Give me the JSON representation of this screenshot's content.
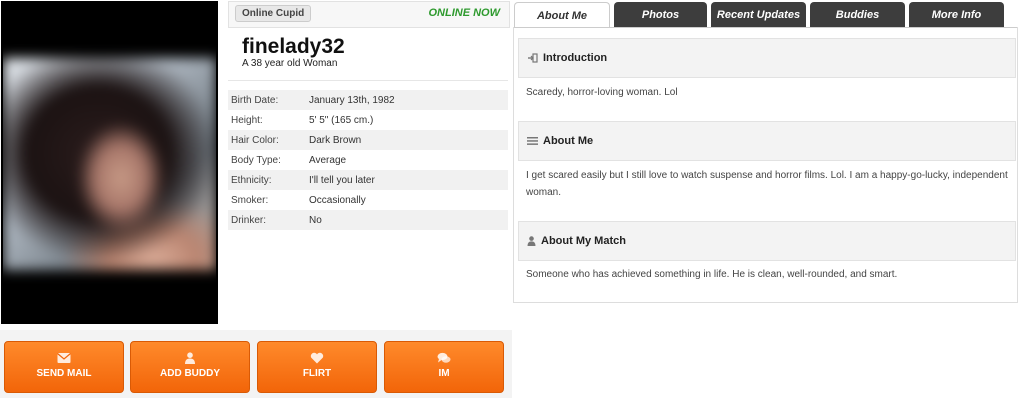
{
  "profile": {
    "site_badge": "Online Cupid",
    "online_status": "ONLINE NOW",
    "username": "finelady32",
    "subtitle": "A 38 year old Woman",
    "details": [
      {
        "label": "Birth Date:",
        "value": "January 13th, 1982"
      },
      {
        "label": "Height:",
        "value": "5' 5\" (165 cm.)"
      },
      {
        "label": "Hair Color:",
        "value": "Dark Brown"
      },
      {
        "label": "Body Type:",
        "value": "Average"
      },
      {
        "label": "Ethnicity:",
        "value": "I'll tell you later"
      },
      {
        "label": "Smoker:",
        "value": "Occasionally"
      },
      {
        "label": "Drinker:",
        "value": "No"
      }
    ]
  },
  "actions": {
    "send_mail": {
      "label": "SEND MAIL",
      "icon": "envelope-icon"
    },
    "add_buddy": {
      "label": "ADD BUDDY",
      "icon": "person-icon"
    },
    "flirt": {
      "label": "FLIRT",
      "icon": "heart-icon"
    },
    "im": {
      "label": "IM",
      "icon": "chat-bubbles-icon"
    }
  },
  "tabs": [
    {
      "label": "About Me",
      "active": true
    },
    {
      "label": "Photos",
      "active": false
    },
    {
      "label": "Recent Updates",
      "active": false
    },
    {
      "label": "Buddies",
      "active": false
    },
    {
      "label": "More Info",
      "active": false
    }
  ],
  "sections": {
    "introduction": {
      "title": "Introduction",
      "text": "Scaredy, horror-loving woman. Lol"
    },
    "about_me": {
      "title": "About Me",
      "text": "I get scared easily but I still love to watch suspense and horror films. Lol. I am a happy-go-lucky, independent woman."
    },
    "about_my_match": {
      "title": "About My Match",
      "text": "Someone who has achieved something in life. He is clean, well-rounded, and smart."
    }
  },
  "colors": {
    "accent_orange": "#f26509",
    "online_green": "#2e9a2e",
    "tab_dark": "#3d3d3d"
  }
}
